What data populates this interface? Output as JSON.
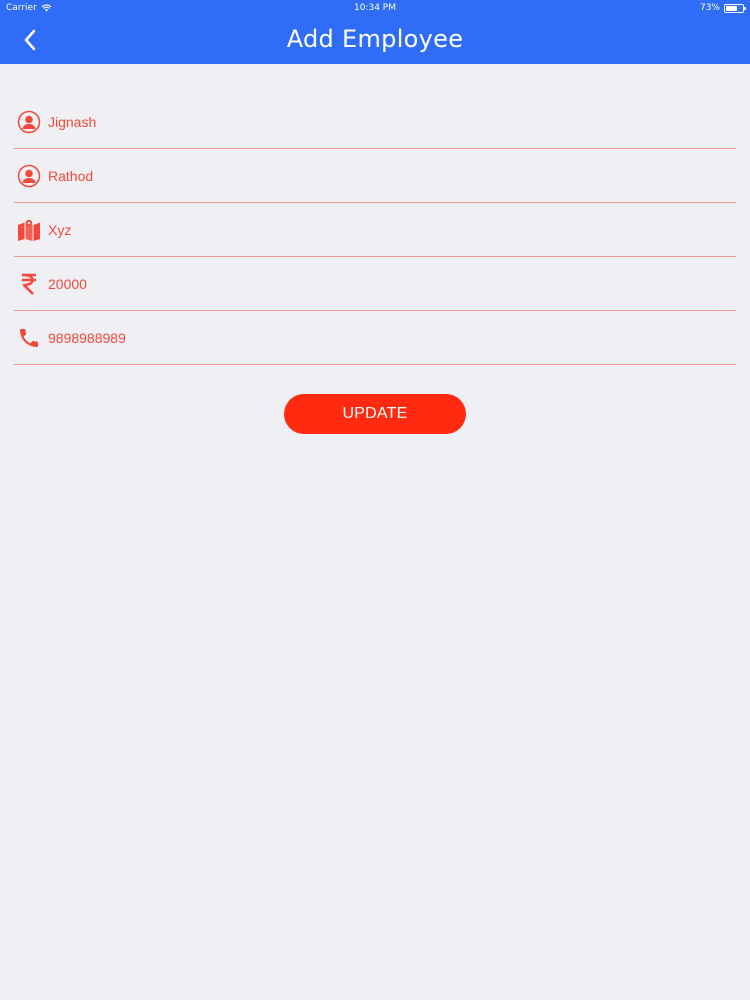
{
  "status_bar": {
    "carrier": "Carrier",
    "time": "10:34 PM",
    "battery": "73%",
    "battery_level": 0.73
  },
  "nav": {
    "title": "Add Employee",
    "back_icon": "chevron-left-icon"
  },
  "form": {
    "fields": [
      {
        "name": "first-name",
        "value": "Jignash",
        "icon": "person-icon"
      },
      {
        "name": "last-name",
        "value": "Rathod",
        "icon": "person-icon"
      },
      {
        "name": "address",
        "value": "Xyz",
        "icon": "map-icon"
      },
      {
        "name": "salary",
        "value": "20000",
        "icon": "rupee-icon"
      },
      {
        "name": "phone",
        "value": "9898988989",
        "icon": "phone-icon"
      }
    ],
    "submit_label": "UPDATE"
  },
  "colors": {
    "nav_blue": "#2f6df8",
    "accent_red": "#f2493a",
    "button_red": "#ff2a10",
    "divider": "#f39a8d",
    "background": "#efeff4"
  }
}
